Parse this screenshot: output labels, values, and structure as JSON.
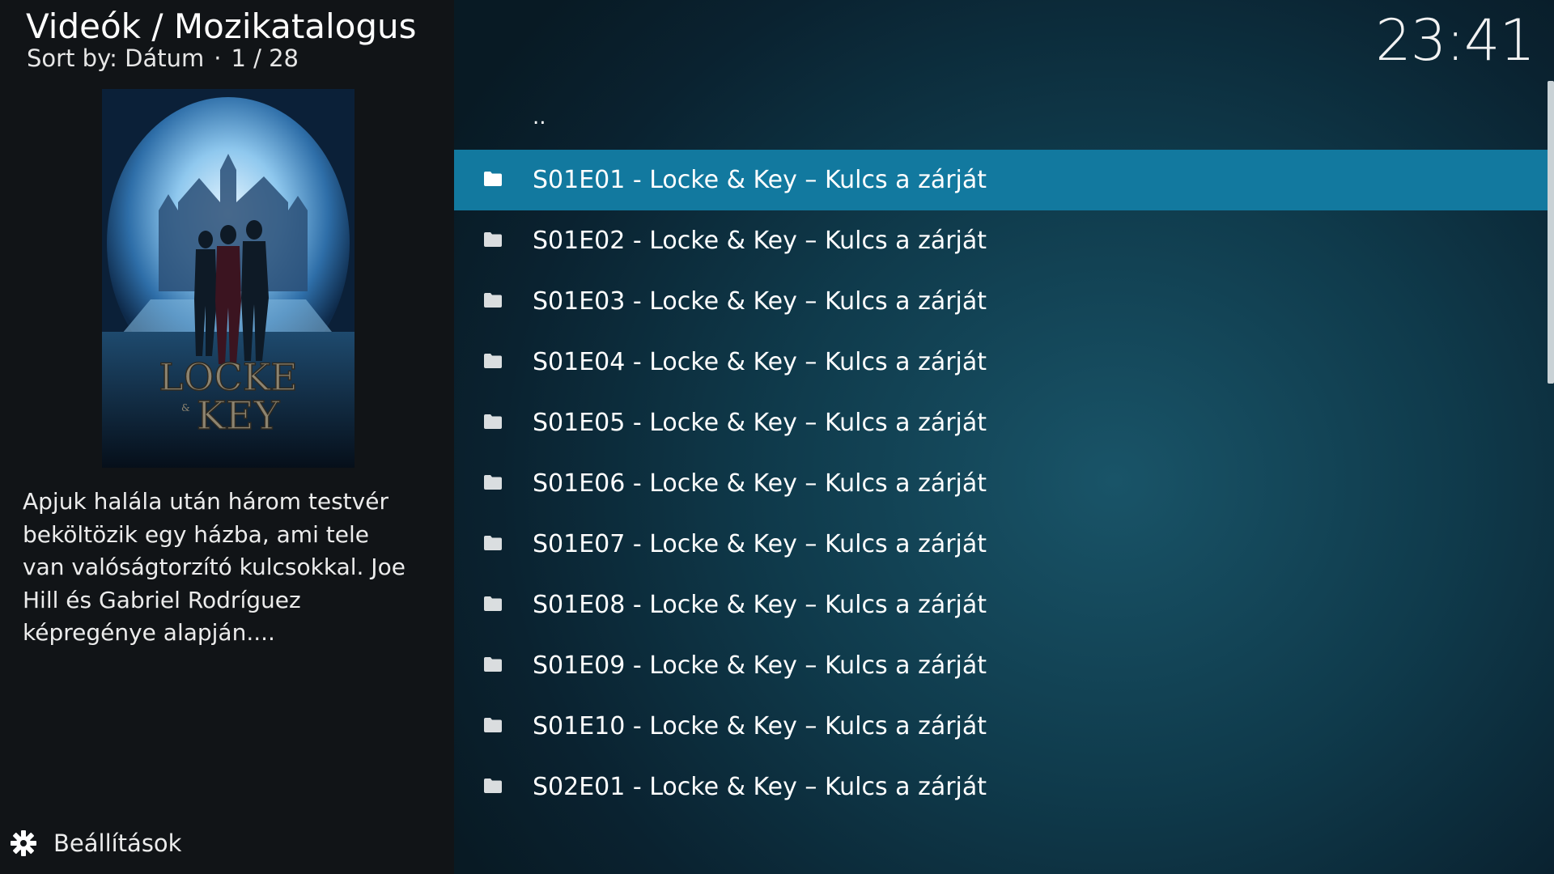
{
  "header": {
    "breadcrumb": "Videók / Mozikatalogus",
    "sort_label": "Sort by: Dátum",
    "separator": "·",
    "position": "1 / 28"
  },
  "clock": "23:41",
  "info": {
    "poster_title": "LOCKE & KEY",
    "plot": "Apjuk halála után három testvér beköltözik egy házba, ami tele van valóságtorzító kulcsokkal. Joe Hill és Gabriel Rodríguez képregénye alapján...."
  },
  "footer": {
    "settings_label": "Beállítások"
  },
  "list": {
    "parent_label": "..",
    "items": [
      {
        "label": "S01E01 - Locke & Key – Kulcs a zárját",
        "icon": "folder-icon",
        "selected": true
      },
      {
        "label": "S01E02 - Locke & Key – Kulcs a zárját",
        "icon": "folder-icon"
      },
      {
        "label": "S01E03 - Locke & Key – Kulcs a zárját",
        "icon": "folder-icon"
      },
      {
        "label": "S01E04 - Locke & Key – Kulcs a zárját",
        "icon": "folder-icon"
      },
      {
        "label": "S01E05 - Locke & Key – Kulcs a zárját",
        "icon": "folder-icon"
      },
      {
        "label": "S01E06 - Locke & Key – Kulcs a zárját",
        "icon": "folder-icon"
      },
      {
        "label": "S01E07 - Locke & Key – Kulcs a zárját",
        "icon": "folder-icon"
      },
      {
        "label": "S01E08 - Locke & Key – Kulcs a zárját",
        "icon": "folder-icon"
      },
      {
        "label": "S01E09 - Locke & Key – Kulcs a zárját",
        "icon": "folder-icon"
      },
      {
        "label": "S01E10 - Locke & Key – Kulcs a zárját",
        "icon": "folder-icon"
      },
      {
        "label": "S02E01 - Locke & Key – Kulcs a zárját",
        "icon": "folder-icon"
      }
    ]
  },
  "colors": {
    "selection": "#12799f",
    "left_panel": "#111417",
    "list_background": "#0f3a4b"
  }
}
